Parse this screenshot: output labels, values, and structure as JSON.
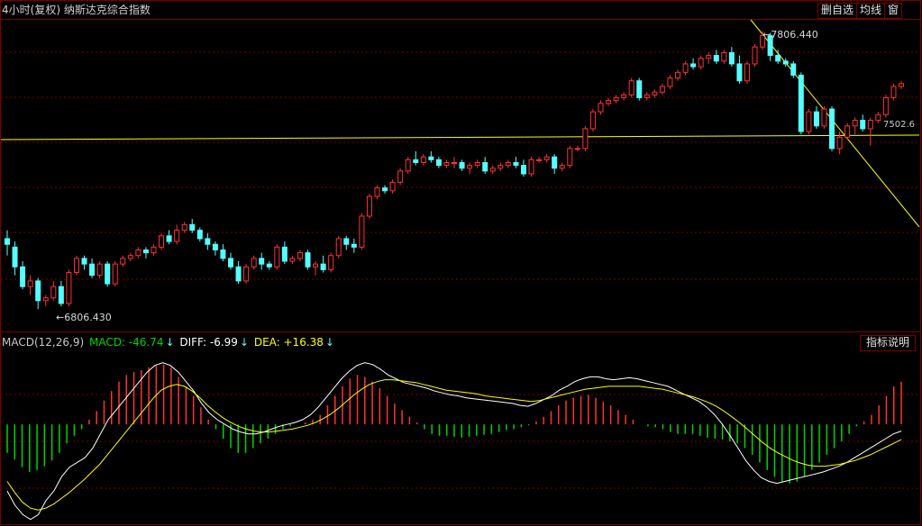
{
  "header": {
    "title": "4小时(复权)  纳斯达克综合指数",
    "buttons": [
      "删自选",
      "均线",
      "窗"
    ]
  },
  "macd_legend": {
    "params": "MACD(12,26,9)",
    "macd": "MACD: -46.74",
    "diff": "DIFF: -6.99",
    "dea": "DEA: +16.38",
    "arrow": "↓",
    "button": "指标说明"
  },
  "annotations": {
    "high": "7806.440",
    "low": "6806.430",
    "right_price": "7502.6"
  },
  "colors": {
    "up": "#ff3232",
    "down": "#54ffff",
    "diff_line": "#ffffff",
    "dea_line": "#ffff00",
    "macd_pos": "#ff3232",
    "macd_neg": "#00d400",
    "grid": "#7a0000",
    "trendline": "#ffff00"
  },
  "chart_data": [
    {
      "type": "candlestick",
      "title": "纳斯达克综合指数",
      "timeframe": "4小时(复权)",
      "high_label": 7806.44,
      "low_label": 6806.43,
      "last_price": 7502.6,
      "grid": true,
      "ohlc": [
        [
          7070,
          7100,
          7010,
          7050
        ],
        [
          7040,
          7060,
          6940,
          6970
        ],
        [
          6970,
          6990,
          6890,
          6900
        ],
        [
          6900,
          6940,
          6870,
          6920
        ],
        [
          6920,
          6930,
          6820,
          6850
        ],
        [
          6850,
          6870,
          6830,
          6860
        ],
        [
          6860,
          6920,
          6850,
          6900
        ],
        [
          6900,
          6920,
          6830,
          6840
        ],
        [
          6840,
          6960,
          6830,
          6950
        ],
        [
          6950,
          7010,
          6940,
          7000
        ],
        [
          7000,
          7010,
          6960,
          6980
        ],
        [
          6980,
          7000,
          6930,
          6940
        ],
        [
          6940,
          6990,
          6930,
          6980
        ],
        [
          6980,
          6990,
          6900,
          6910
        ],
        [
          6910,
          6990,
          6900,
          6980
        ],
        [
          6980,
          7010,
          6970,
          7000
        ],
        [
          7000,
          7020,
          6990,
          7010
        ],
        [
          7010,
          7040,
          7000,
          7030
        ],
        [
          7030,
          7040,
          7000,
          7020
        ],
        [
          7020,
          7050,
          7010,
          7040
        ],
        [
          7040,
          7090,
          7030,
          7080
        ],
        [
          7080,
          7100,
          7050,
          7060
        ],
        [
          7060,
          7120,
          7050,
          7100
        ],
        [
          7100,
          7130,
          7090,
          7120
        ],
        [
          7120,
          7140,
          7090,
          7100
        ],
        [
          7100,
          7110,
          7060,
          7070
        ],
        [
          7070,
          7090,
          7030,
          7050
        ],
        [
          7050,
          7060,
          7010,
          7030
        ],
        [
          7030,
          7050,
          6990,
          7000
        ],
        [
          7000,
          7020,
          6960,
          6970
        ],
        [
          6970,
          6990,
          6910,
          6920
        ],
        [
          6920,
          6980,
          6910,
          6970
        ],
        [
          6970,
          7010,
          6960,
          7000
        ],
        [
          7000,
          7020,
          6960,
          6980
        ],
        [
          6980,
          6990,
          6960,
          6970
        ],
        [
          6970,
          7050,
          6960,
          7040
        ],
        [
          7040,
          7060,
          6980,
          6990
        ],
        [
          6990,
          7010,
          6980,
          7000
        ],
        [
          7000,
          7030,
          6990,
          7020
        ],
        [
          7020,
          7030,
          6960,
          6970
        ],
        [
          6970,
          6990,
          6940,
          6980
        ],
        [
          6980,
          7010,
          6950,
          6960
        ],
        [
          6960,
          7020,
          6950,
          7010
        ],
        [
          7010,
          7080,
          7000,
          7070
        ],
        [
          7070,
          7080,
          7030,
          7050
        ],
        [
          7050,
          7070,
          7020,
          7040
        ],
        [
          7040,
          7160,
          7030,
          7150
        ],
        [
          7150,
          7230,
          7140,
          7220
        ],
        [
          7220,
          7260,
          7210,
          7250
        ],
        [
          7250,
          7260,
          7230,
          7240
        ],
        [
          7240,
          7280,
          7230,
          7270
        ],
        [
          7270,
          7320,
          7260,
          7310
        ],
        [
          7310,
          7360,
          7300,
          7350
        ],
        [
          7350,
          7380,
          7330,
          7340
        ],
        [
          7340,
          7370,
          7330,
          7360
        ],
        [
          7360,
          7380,
          7340,
          7350
        ],
        [
          7350,
          7360,
          7320,
          7330
        ],
        [
          7330,
          7350,
          7320,
          7340
        ],
        [
          7340,
          7360,
          7320,
          7340
        ],
        [
          7340,
          7350,
          7310,
          7320
        ],
        [
          7320,
          7340,
          7300,
          7330
        ],
        [
          7330,
          7350,
          7320,
          7340
        ],
        [
          7340,
          7360,
          7300,
          7310
        ],
        [
          7310,
          7330,
          7300,
          7320
        ],
        [
          7320,
          7340,
          7310,
          7330
        ],
        [
          7330,
          7350,
          7320,
          7340
        ],
        [
          7340,
          7360,
          7320,
          7330
        ],
        [
          7330,
          7350,
          7290,
          7300
        ],
        [
          7300,
          7360,
          7290,
          7350
        ],
        [
          7350,
          7360,
          7340,
          7350
        ],
        [
          7350,
          7370,
          7340,
          7360
        ],
        [
          7360,
          7370,
          7300,
          7320
        ],
        [
          7320,
          7340,
          7310,
          7330
        ],
        [
          7330,
          7400,
          7320,
          7390
        ],
        [
          7390,
          7400,
          7380,
          7390
        ],
        [
          7390,
          7470,
          7380,
          7460
        ],
        [
          7460,
          7530,
          7450,
          7520
        ],
        [
          7520,
          7560,
          7510,
          7550
        ],
        [
          7550,
          7570,
          7540,
          7560
        ],
        [
          7560,
          7580,
          7550,
          7570
        ],
        [
          7570,
          7590,
          7560,
          7580
        ],
        [
          7580,
          7640,
          7570,
          7630
        ],
        [
          7630,
          7640,
          7560,
          7570
        ],
        [
          7570,
          7590,
          7560,
          7580
        ],
        [
          7580,
          7600,
          7570,
          7590
        ],
        [
          7590,
          7620,
          7580,
          7610
        ],
        [
          7610,
          7650,
          7600,
          7640
        ],
        [
          7640,
          7670,
          7630,
          7660
        ],
        [
          7660,
          7700,
          7650,
          7690
        ],
        [
          7690,
          7710,
          7670,
          7680
        ],
        [
          7680,
          7720,
          7670,
          7710
        ],
        [
          7710,
          7730,
          7690,
          7720
        ],
        [
          7720,
          7740,
          7690,
          7700
        ],
        [
          7700,
          7740,
          7690,
          7730
        ],
        [
          7730,
          7750,
          7680,
          7690
        ],
        [
          7690,
          7720,
          7620,
          7630
        ],
        [
          7630,
          7700,
          7620,
          7690
        ],
        [
          7690,
          7760,
          7680,
          7750
        ],
        [
          7750,
          7806,
          7740,
          7790
        ],
        [
          7790,
          7800,
          7700,
          7720
        ],
        [
          7720,
          7740,
          7690,
          7700
        ],
        [
          7700,
          7710,
          7680,
          7690
        ],
        [
          7690,
          7700,
          7640,
          7650
        ],
        [
          7650,
          7660,
          7440,
          7450
        ],
        [
          7450,
          7530,
          7440,
          7520
        ],
        [
          7520,
          7540,
          7460,
          7470
        ],
        [
          7470,
          7540,
          7460,
          7530
        ],
        [
          7530,
          7540,
          7380,
          7390
        ],
        [
          7390,
          7450,
          7370,
          7430
        ],
        [
          7430,
          7480,
          7420,
          7470
        ],
        [
          7470,
          7500,
          7440,
          7490
        ],
        [
          7490,
          7510,
          7450,
          7460
        ],
        [
          7460,
          7500,
          7400,
          7490
        ],
        [
          7490,
          7520,
          7480,
          7510
        ],
        [
          7510,
          7580,
          7500,
          7570
        ],
        [
          7570,
          7620,
          7560,
          7610
        ],
        [
          7610,
          7630,
          7600,
          7620
        ]
      ]
    },
    {
      "type": "macd",
      "params": [
        12,
        26,
        9
      ],
      "macd": -46.74,
      "diff": -6.99,
      "dea": 16.38,
      "y_range": [
        -105,
        75
      ],
      "macd_hist": [
        -30,
        -37,
        -45,
        -50,
        -48,
        -44,
        -38,
        -30,
        -20,
        -12,
        -5,
        5,
        14,
        25,
        35,
        45,
        52,
        55,
        57,
        60,
        62,
        63,
        60,
        50,
        40,
        30,
        18,
        5,
        -5,
        -15,
        -25,
        -30,
        -30,
        -25,
        -20,
        -15,
        -10,
        -5,
        -2,
        0,
        2,
        5,
        10,
        20,
        30,
        40,
        48,
        52,
        50,
        45,
        38,
        30,
        22,
        15,
        8,
        2,
        -5,
        -10,
        -12,
        -12,
        -13,
        -14,
        -13,
        -12,
        -11,
        -10,
        -8,
        -6,
        -5,
        -3,
        -1,
        3,
        8,
        14,
        20,
        25,
        28,
        30,
        31,
        28,
        24,
        20,
        15,
        10,
        5,
        0,
        -2,
        -3,
        -5,
        -8,
        -10,
        -10,
        -10,
        -12,
        -14,
        -15,
        -16,
        -18,
        -20,
        -25,
        -32,
        -40,
        -48,
        -55,
        -60,
        -62,
        -60,
        -55,
        -48,
        -40,
        -32,
        -25,
        -18,
        -10,
        -2,
        3,
        10,
        20,
        30,
        40,
        45
      ],
      "diff_line": [
        -70,
        -85,
        -95,
        -100,
        -95,
        -80,
        -70,
        -55,
        -45,
        -40,
        -35,
        -25,
        -10,
        5,
        15,
        25,
        35,
        45,
        55,
        62,
        65,
        62,
        55,
        45,
        35,
        22,
        12,
        5,
        0,
        -5,
        -8,
        -10,
        -10,
        -8,
        -5,
        -2,
        0,
        2,
        5,
        10,
        18,
        28,
        38,
        48,
        56,
        62,
        65,
        63,
        58,
        52,
        48,
        44,
        42,
        40,
        38,
        35,
        33,
        31,
        30,
        28,
        27,
        26,
        25,
        24,
        23,
        22,
        20,
        19,
        22,
        26,
        30,
        36,
        40,
        45,
        48,
        50,
        50,
        48,
        47,
        48,
        49,
        48,
        46,
        44,
        42,
        40,
        36,
        32,
        28,
        24,
        18,
        10,
        0,
        -12,
        -25,
        -38,
        -48,
        -56,
        -60,
        -62,
        -60,
        -58,
        -56,
        -54,
        -52,
        -50,
        -47,
        -44,
        -40,
        -35,
        -30,
        -25,
        -20,
        -15,
        -10,
        -7
      ],
      "dea_line": [
        -60,
        -72,
        -82,
        -88,
        -90,
        -88,
        -84,
        -78,
        -72,
        -65,
        -58,
        -50,
        -42,
        -32,
        -22,
        -12,
        -2,
        8,
        18,
        28,
        36,
        40,
        42,
        40,
        35,
        28,
        20,
        13,
        7,
        2,
        -2,
        -5,
        -7,
        -8,
        -8,
        -7,
        -6,
        -5,
        -3,
        -1,
        2,
        6,
        11,
        17,
        24,
        31,
        37,
        42,
        45,
        47,
        47,
        46,
        45,
        44,
        42,
        40,
        38,
        36,
        35,
        34,
        33,
        32,
        30,
        29,
        28,
        27,
        26,
        25,
        24,
        25,
        27,
        29,
        31,
        33,
        35,
        37,
        38,
        39,
        40,
        40,
        40,
        40,
        40,
        39,
        38,
        37,
        35,
        33,
        31,
        29,
        26,
        23,
        19,
        14,
        8,
        2,
        -5,
        -12,
        -19,
        -25,
        -30,
        -34,
        -38,
        -41,
        -43,
        -44,
        -44,
        -43,
        -42,
        -40,
        -38,
        -35,
        -32,
        -28,
        -24,
        -20,
        -16
      ]
    }
  ]
}
